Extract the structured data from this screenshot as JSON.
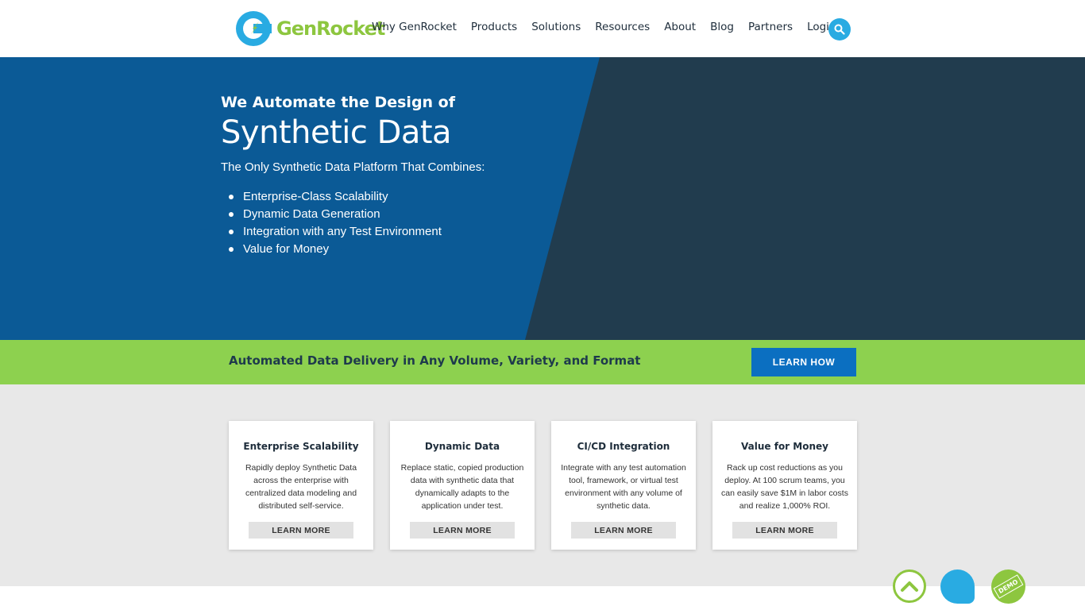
{
  "header": {
    "logo_text": "GenRocket",
    "nav": [
      "Why GenRocket",
      "Products",
      "Solutions",
      "Resources",
      "About",
      "Blog",
      "Partners",
      "Login"
    ],
    "search_icon": "search-icon"
  },
  "hero": {
    "kicker": "We Automate the Design of",
    "title": "Synthetic Data",
    "intro": "The Only Synthetic Data Platform That Combines:",
    "bullets": [
      "Enterprise-Class Scalability",
      "Dynamic Data Generation",
      "Integration with any Test Environment",
      "Value for Money"
    ]
  },
  "band": {
    "text": "Automated Data Delivery in Any Volume, Variety, and Format",
    "button": "LEARN HOW"
  },
  "cards": [
    {
      "title": "Enterprise Scalability",
      "body": "Rapidly deploy Synthetic Data across the enterprise with centralized data modeling and distributed self-service.",
      "button": "LEARN MORE"
    },
    {
      "title": "Dynamic Data",
      "body": "Replace static, copied production data with synthetic data that dynamically adapts to the application under test.",
      "button": "LEARN MORE"
    },
    {
      "title": "CI/CD Integration",
      "body": "Integrate with any test automation tool, framework, or virtual test environment with any volume of synthetic data.",
      "button": "LEARN MORE"
    },
    {
      "title": "Value for Money",
      "body": "Rack up cost reductions as you deploy. At 100 scrum teams, you can easily save $1M in labor costs and realize 1,000% ROI.",
      "button": "LEARN MORE"
    }
  ],
  "floating": {
    "demo_label": "DEMO"
  },
  "colors": {
    "hero_blue": "#0b5a96",
    "hero_dark": "#213c4e",
    "band_green": "#8dd14f",
    "button_blue": "#0b6fc1",
    "accent_cyan": "#29abe2",
    "logo_green": "#8dc63f"
  }
}
